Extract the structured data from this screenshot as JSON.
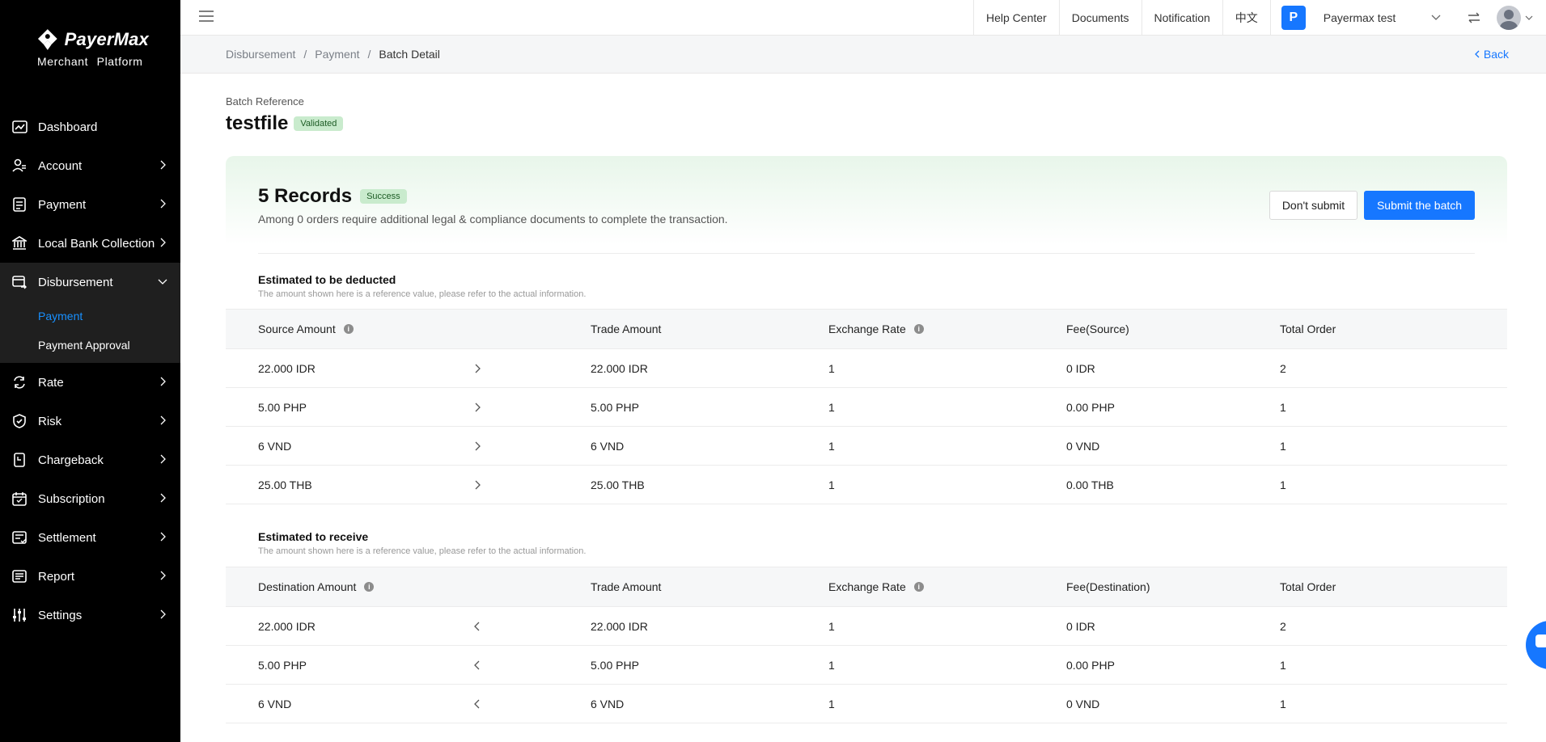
{
  "logo": {
    "brand": "PayerMax",
    "subtitle": "Merchant  Platform"
  },
  "sidebar": {
    "items": [
      {
        "label": "Dashboard",
        "icon": "dashboard-icon"
      },
      {
        "label": "Account",
        "icon": "account-icon"
      },
      {
        "label": "Payment",
        "icon": "payment-icon"
      },
      {
        "label": "Local Bank Collection",
        "icon": "bank-icon"
      },
      {
        "label": "Disbursement",
        "icon": "disbursement-icon"
      },
      {
        "label": "Rate",
        "icon": "rate-icon"
      },
      {
        "label": "Risk",
        "icon": "risk-icon"
      },
      {
        "label": "Chargeback",
        "icon": "chargeback-icon"
      },
      {
        "label": "Subscription",
        "icon": "subscription-icon"
      },
      {
        "label": "Settlement",
        "icon": "settlement-icon"
      },
      {
        "label": "Report",
        "icon": "report-icon"
      },
      {
        "label": "Settings",
        "icon": "settings-icon"
      }
    ],
    "disbursement_sub": [
      {
        "label": "Payment",
        "active": true
      },
      {
        "label": "Payment Approval",
        "active": false
      }
    ]
  },
  "topbar": {
    "links": [
      "Help Center",
      "Documents",
      "Notification",
      "中文"
    ],
    "merchant_initial": "P",
    "merchant_name": "Payermax test"
  },
  "breadcrumb": {
    "items": [
      "Disbursement",
      "Payment",
      "Batch Detail"
    ],
    "separator": "/",
    "back": "Back"
  },
  "batch": {
    "label": "Batch Reference",
    "name": "testfile",
    "status": "Validated"
  },
  "summary": {
    "records": "5 Records",
    "status": "Success",
    "description": "Among 0 orders require additional legal & compliance documents to complete the transaction.",
    "dont_submit": "Don't submit",
    "submit": "Submit the batch"
  },
  "deducted": {
    "title": "Estimated to be deducted",
    "note": "The amount shown here is a reference value, please refer to the actual information.",
    "headers": [
      "Source Amount",
      "Trade Amount",
      "Exchange Rate",
      "Fee(Source)",
      "Total Order"
    ],
    "rows": [
      [
        "22.000 IDR",
        "22.000 IDR",
        "1",
        "0 IDR",
        "2"
      ],
      [
        "5.00 PHP",
        "5.00 PHP",
        "1",
        "0.00 PHP",
        "1"
      ],
      [
        "6 VND",
        "6 VND",
        "1",
        "0 VND",
        "1"
      ],
      [
        "25.00 THB",
        "25.00 THB",
        "1",
        "0.00 THB",
        "1"
      ]
    ]
  },
  "receive": {
    "title": "Estimated to receive",
    "note": "The amount shown here is a reference value, please refer to the actual information.",
    "headers": [
      "Destination Amount",
      "Trade Amount",
      "Exchange Rate",
      "Fee(Destination)",
      "Total Order"
    ],
    "rows": [
      [
        "22.000 IDR",
        "22.000 IDR",
        "1",
        "0 IDR",
        "2"
      ],
      [
        "5.00 PHP",
        "5.00 PHP",
        "1",
        "0.00 PHP",
        "1"
      ],
      [
        "6 VND",
        "6 VND",
        "1",
        "0 VND",
        "1"
      ]
    ]
  },
  "colors": {
    "accent": "#1677ff",
    "success_tag_bg": "#c9ebcd",
    "sidebar_bg": "#000000"
  }
}
